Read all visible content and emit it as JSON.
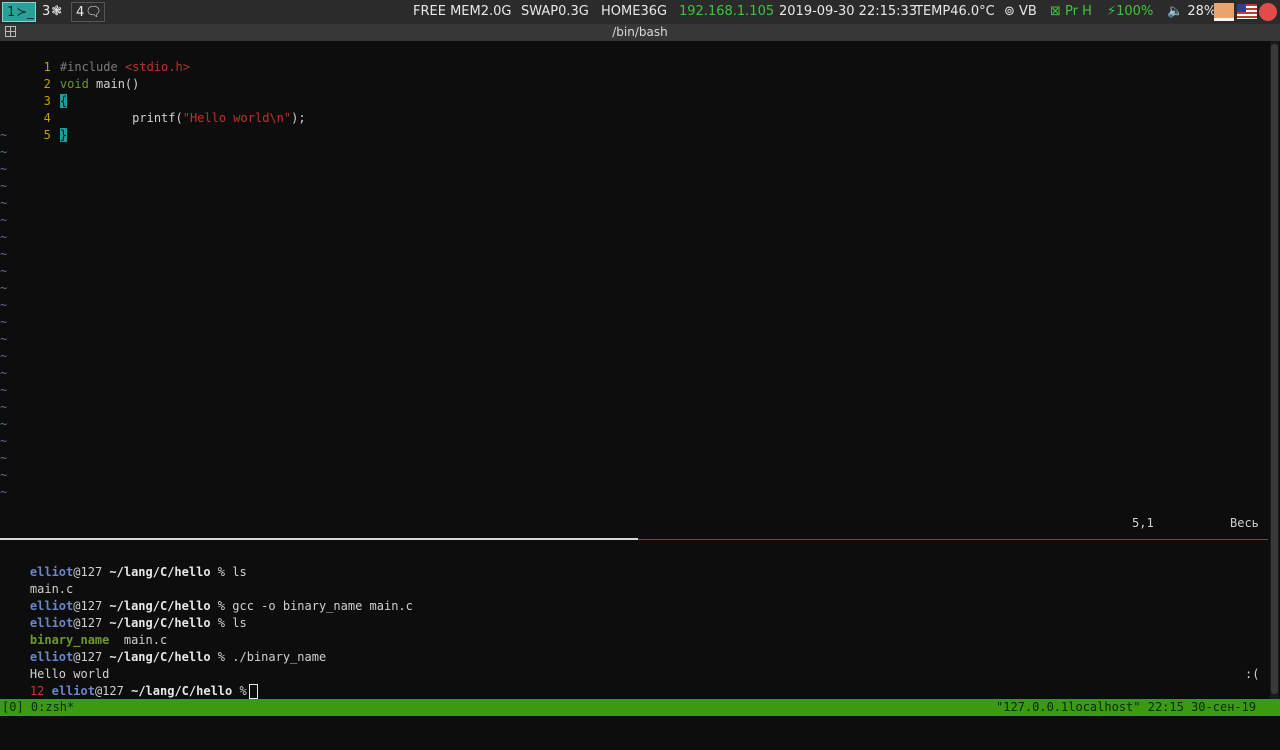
{
  "panel": {
    "workspaces": [
      {
        "label": "1",
        "glyph": "≻_"
      },
      {
        "label": "3",
        "glyph": "❃"
      },
      {
        "label": "4",
        "glyph": "🗨"
      }
    ],
    "free_mem": "FREE MEM2.0G",
    "swap": "SWAP0.3G",
    "home": "HOME36G",
    "ip": "192.168.1.105",
    "datetime": "2019-09-30 22:15:33",
    "temp": "TEMP46.0°C",
    "vb": "⊚ VB",
    "printer": "⊠ Pr H",
    "battery": "⚡100%",
    "volume": "🔈 28%",
    "colors": {
      "accent": "#2aa198",
      "ok": "#3ec43e"
    }
  },
  "window": {
    "title": "/bin/bash"
  },
  "vim": {
    "lines": [
      {
        "n": "1",
        "pre": "#include ",
        "str": "<stdio.h>"
      },
      {
        "n": "2",
        "kw": "void",
        "rest": " main()"
      },
      {
        "n": "3",
        "brace": "{"
      },
      {
        "n": "4",
        "indent": "          printf(",
        "str": "\"Hello world\\n\"",
        "tail": ");"
      },
      {
        "n": "5",
        "brace": "}"
      }
    ],
    "tilde": "~",
    "tilde_count": 22,
    "position": "5,1",
    "percent": "Весь"
  },
  "shell": {
    "user": "elliot",
    "host": "@127",
    "cwd": "~/lang/C/hello",
    "prompt_char": "%",
    "commands": [
      "ls",
      "gcc -o binary_name main.c",
      "ls",
      "./binary_name"
    ],
    "outputs": {
      "ls1": "main.c",
      "ls2_exe": "binary_name",
      "ls2_file": "main.c",
      "run": "Hello world"
    },
    "exit_code": "12",
    "right_prompt": ":("
  },
  "tmux": {
    "left": "[0] 0:zsh*",
    "right": "\"127.0.0.1localhost\" 22:15 30-сен-19"
  }
}
